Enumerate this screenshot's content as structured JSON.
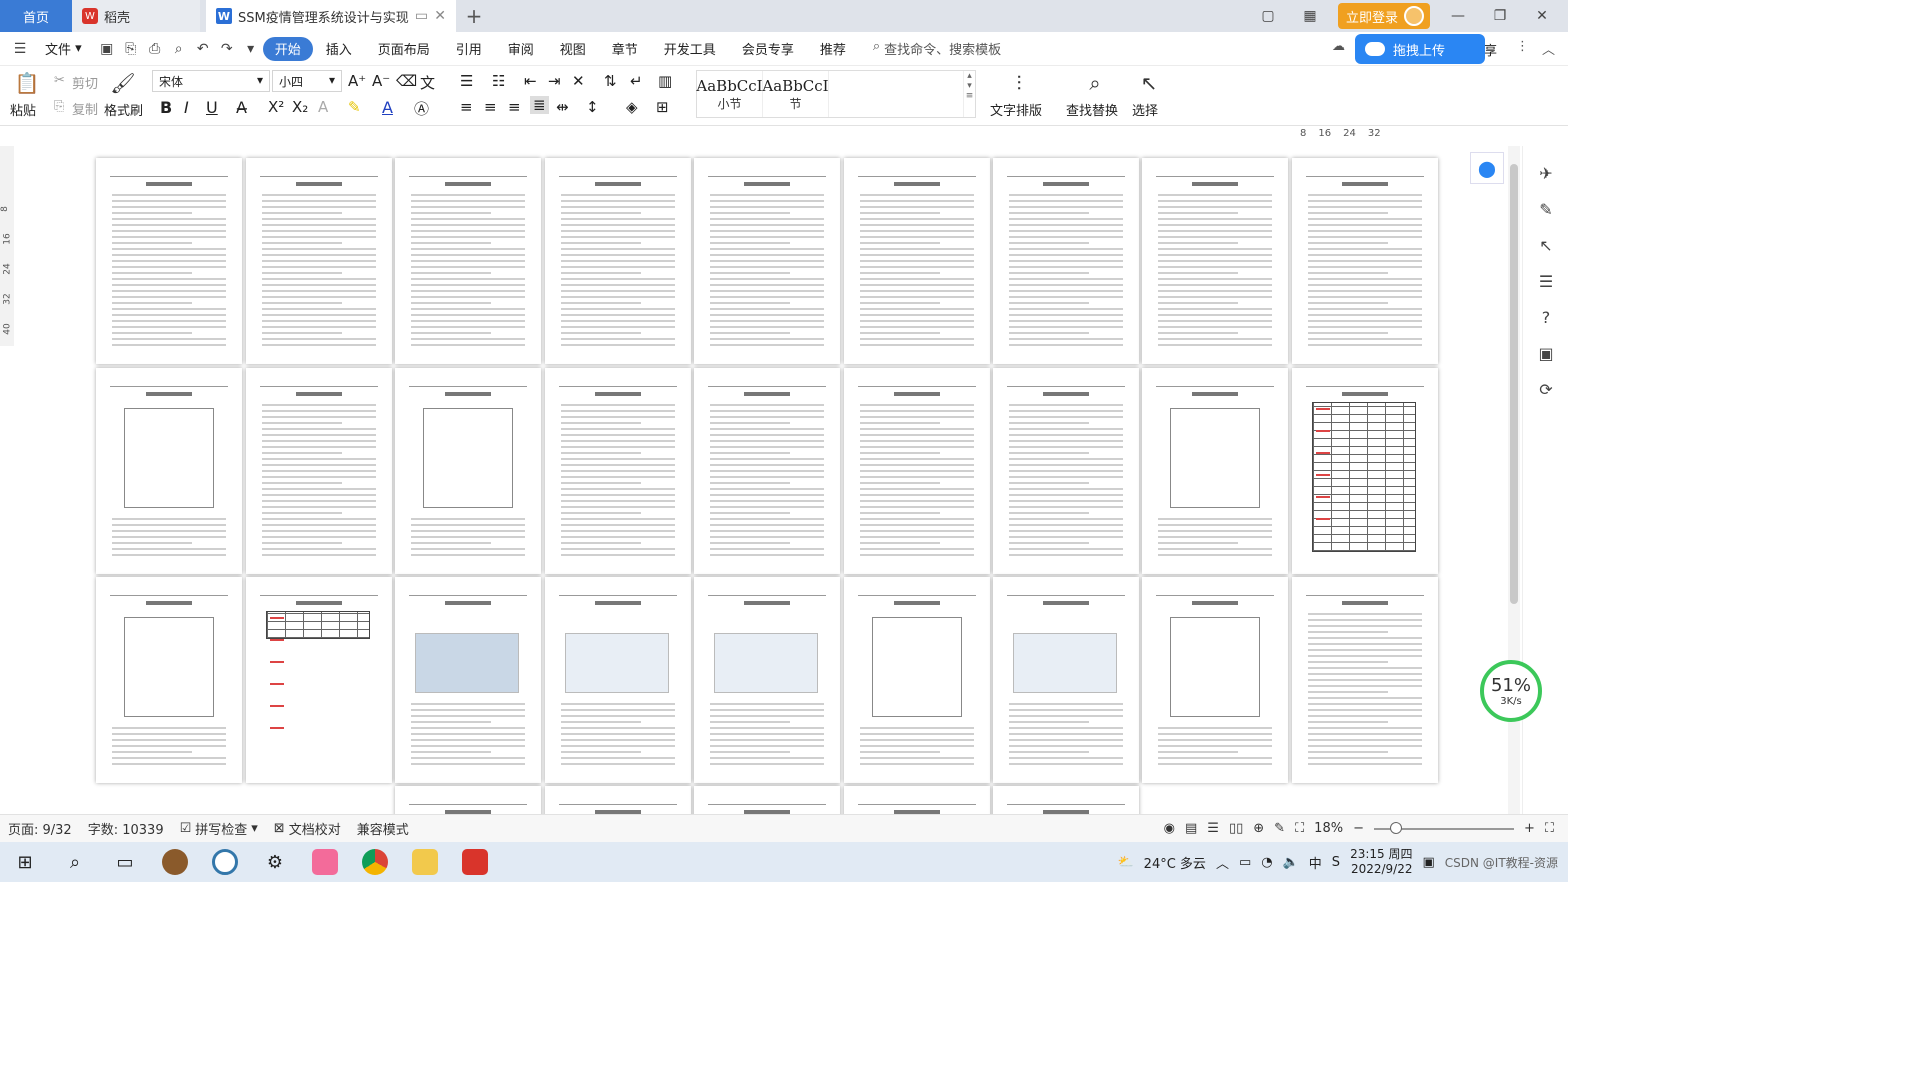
{
  "tabs": {
    "home": "首页",
    "straw": "稻壳",
    "doc_title": "SSM疫情管理系统设计与实现"
  },
  "title_right": {
    "login": "立即登录"
  },
  "menu": {
    "file": "文件",
    "items": [
      "开始",
      "插入",
      "页面布局",
      "引用",
      "审阅",
      "视图",
      "章节",
      "开发工具",
      "会员专享",
      "推荐"
    ],
    "search": "查找命令、搜索模板",
    "upload": "拖拽上传",
    "share_fragment": "享"
  },
  "ribbon": {
    "paste": "粘贴",
    "cut": "剪切",
    "copy": "复制",
    "format_painter": "格式刷",
    "font_name": "宋体",
    "font_size": "小四",
    "styles": [
      {
        "preview": "AaBbCcI",
        "caption": "小节"
      },
      {
        "preview": "AaBbCcI",
        "caption": "节"
      }
    ],
    "text_layout": "文字排版",
    "find_replace": "查找替换",
    "select": "选择"
  },
  "ruler": {
    "h_ticks": [
      "8",
      "16",
      "24",
      "32"
    ],
    "v_ticks": [
      "8",
      "16",
      "24",
      "32",
      "40"
    ]
  },
  "status": {
    "page": "页面: 9/32",
    "words": "字数: 10339",
    "spell": "拼写检查",
    "proof": "文档校对",
    "compat": "兼容模式",
    "zoom": "18%"
  },
  "speed": {
    "pct": "51%",
    "rate": "3K/s"
  },
  "taskbar": {
    "weather": "24°C 多云",
    "time": "23:15 周四",
    "date": "2022/9/22",
    "watermark": "CSDN @IT教程-资源"
  },
  "pages_visible": 31
}
